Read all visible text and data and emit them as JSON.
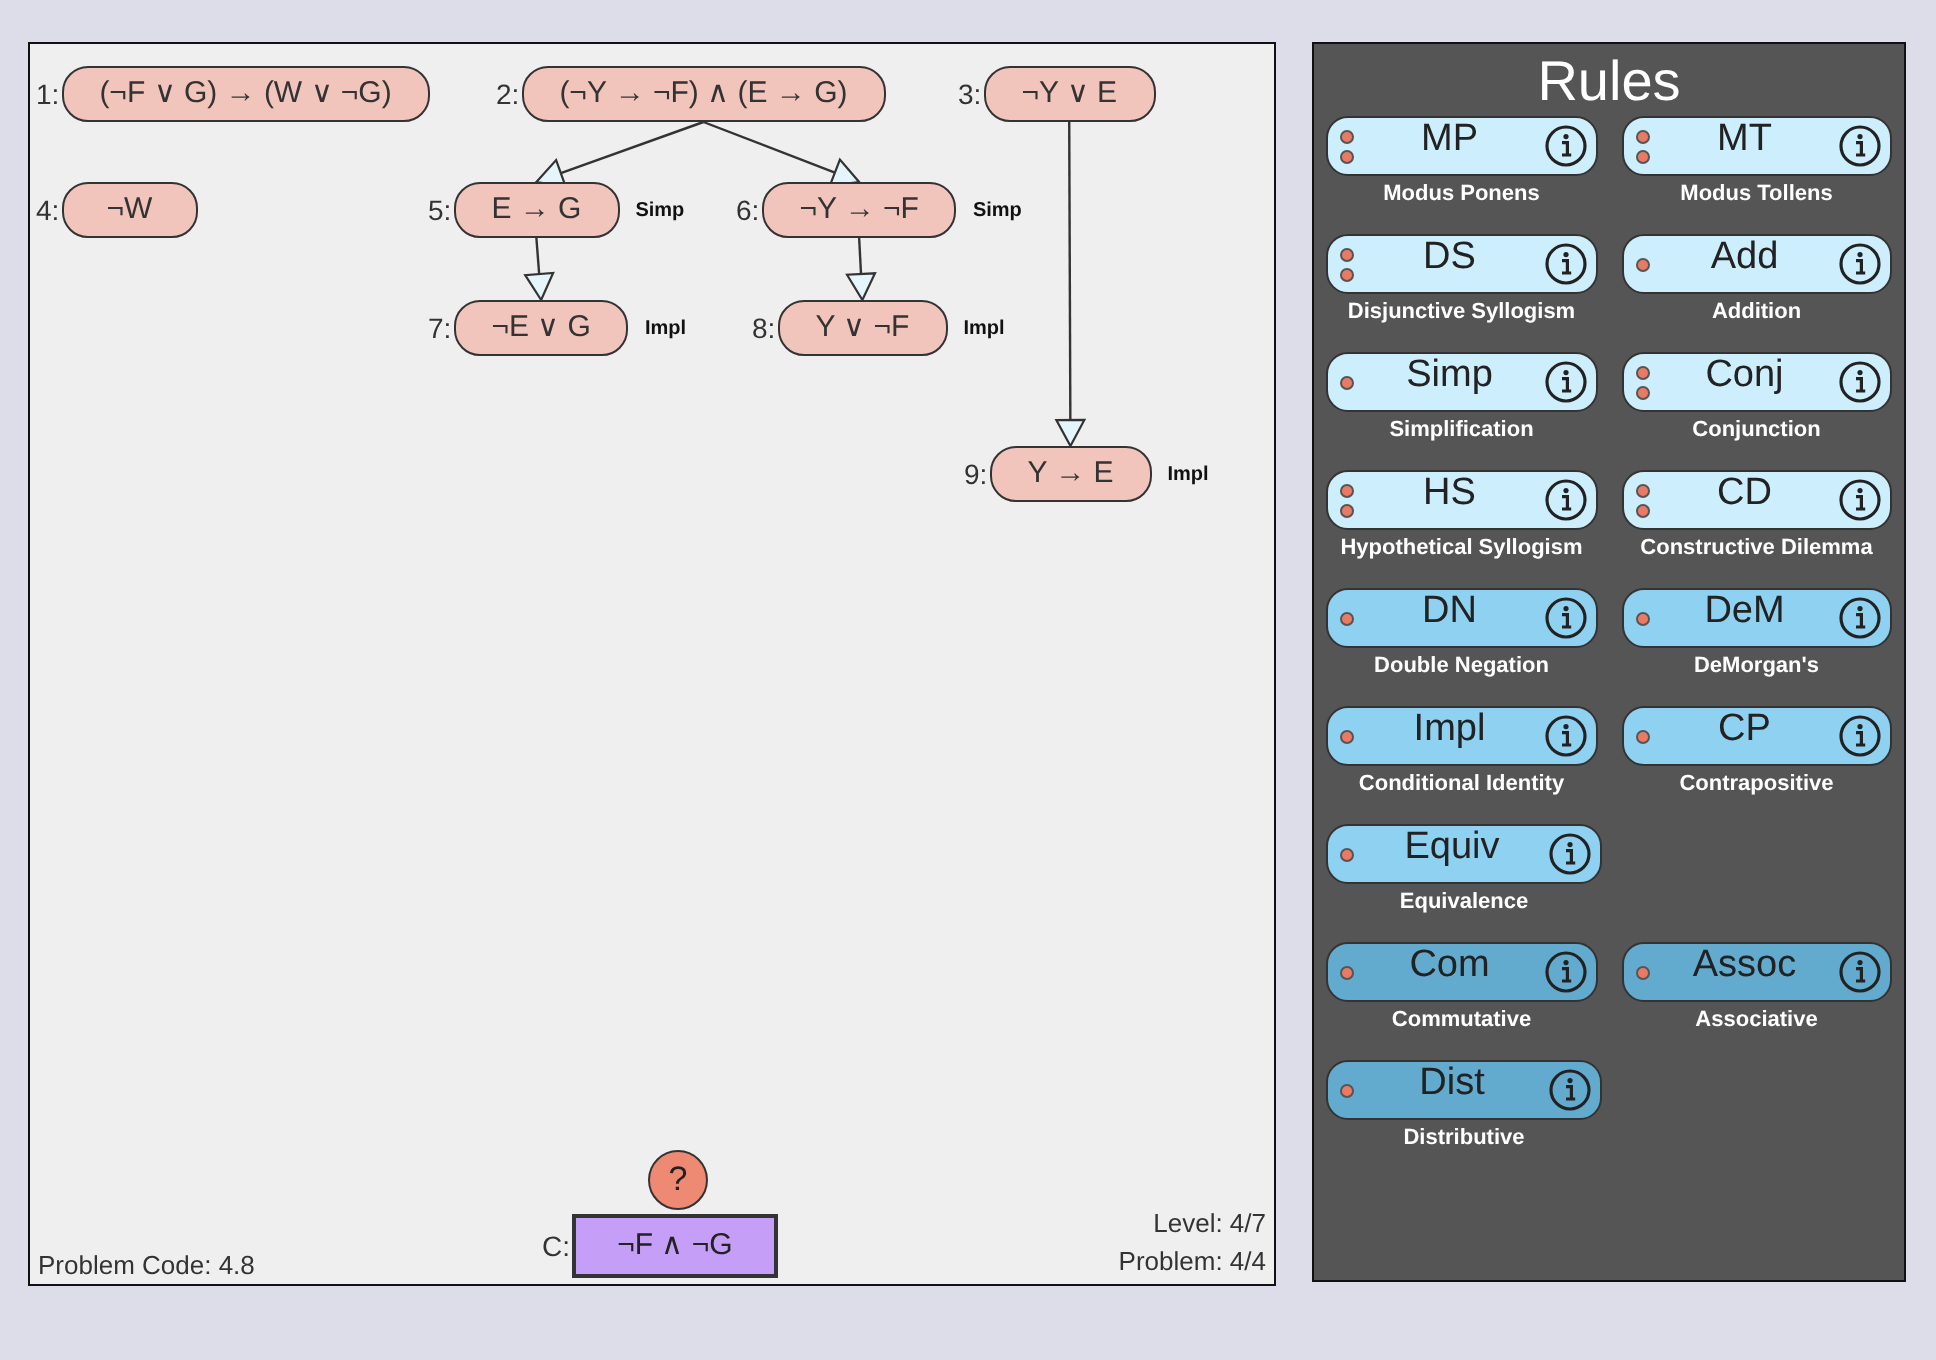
{
  "proof": {
    "lines": [
      {
        "number": "1:",
        "formula": "(¬F ∨ G) → (W ∨ ¬G)"
      },
      {
        "number": "2:",
        "formula": "(¬Y → ¬F) ∧ (E → G)",
        "children": [
          {
            "number": "5:",
            "formula": "E → G",
            "rule": "Simp",
            "children": [
              {
                "number": "7:",
                "formula": "¬E ∨ G",
                "rule": "Impl"
              }
            ]
          },
          {
            "number": "6:",
            "formula": "¬Y → ¬F",
            "rule": "Simp",
            "children": [
              {
                "number": "8:",
                "formula": "Y ∨ ¬F",
                "rule": "Impl"
              }
            ]
          }
        ]
      },
      {
        "number": "3:",
        "formula": "¬Y ∨ E",
        "children": [
          {
            "number": "9:",
            "formula": "Y → E",
            "rule": "Impl"
          }
        ]
      },
      {
        "number": "4:",
        "formula": "¬W"
      }
    ],
    "help": "?",
    "conclusion": {
      "label": "C:",
      "formula": "¬F ∧ ¬G"
    },
    "problem_code": "Problem Code: 4.8",
    "level": "Level: 4/7",
    "problem": "Problem: 4/4"
  },
  "rules": {
    "title": "Rules",
    "rows": [
      [
        {
          "abbr": "MP",
          "name": "Modus Ponens",
          "kind": "two",
          "color": "#cdeefc"
        },
        {
          "abbr": "MT",
          "name": "Modus Tollens",
          "kind": "two",
          "color": "#cdeefc"
        }
      ],
      [
        {
          "abbr": "DS",
          "name": "Disjunctive Syllogism",
          "kind": "two",
          "color": "#cdeefc"
        },
        {
          "abbr": "Add",
          "name": "Addition",
          "kind": "one",
          "color": "#cdeefc"
        }
      ],
      [
        {
          "abbr": "Simp",
          "name": "Simplification",
          "kind": "one",
          "color": "#cdeefc"
        },
        {
          "abbr": "Conj",
          "name": "Conjunction",
          "kind": "two",
          "color": "#cdeefc"
        }
      ],
      [
        {
          "abbr": "HS",
          "name": "Hypothetical Syllogism",
          "kind": "two",
          "color": "#cdeefc"
        },
        {
          "abbr": "CD",
          "name": "Constructive Dilemma",
          "kind": "two",
          "color": "#cdeefc"
        }
      ],
      [
        {
          "abbr": "DN",
          "name": "Double Negation",
          "kind": "one",
          "color": "#8fd1f0"
        },
        {
          "abbr": "DeM",
          "name": "DeMorgan's",
          "kind": "one",
          "color": "#8fd1f0"
        }
      ],
      [
        {
          "abbr": "Impl",
          "name": "Conditional Identity",
          "kind": "one",
          "color": "#8fd1f0"
        },
        {
          "abbr": "CP",
          "name": "Contrapositive",
          "kind": "one",
          "color": "#8fd1f0"
        }
      ],
      [
        {
          "abbr": "Equiv",
          "name": "Equivalence",
          "kind": "one",
          "color": "#8fd1f0"
        }
      ],
      [
        {
          "abbr": "Com",
          "name": "Commutative",
          "kind": "one",
          "color": "#62abcf"
        },
        {
          "abbr": "Assoc",
          "name": "Associative",
          "kind": "one",
          "color": "#62abcf"
        }
      ],
      [
        {
          "abbr": "Dist",
          "name": "Distributive",
          "kind": "one",
          "color": "#62abcf"
        }
      ]
    ]
  }
}
